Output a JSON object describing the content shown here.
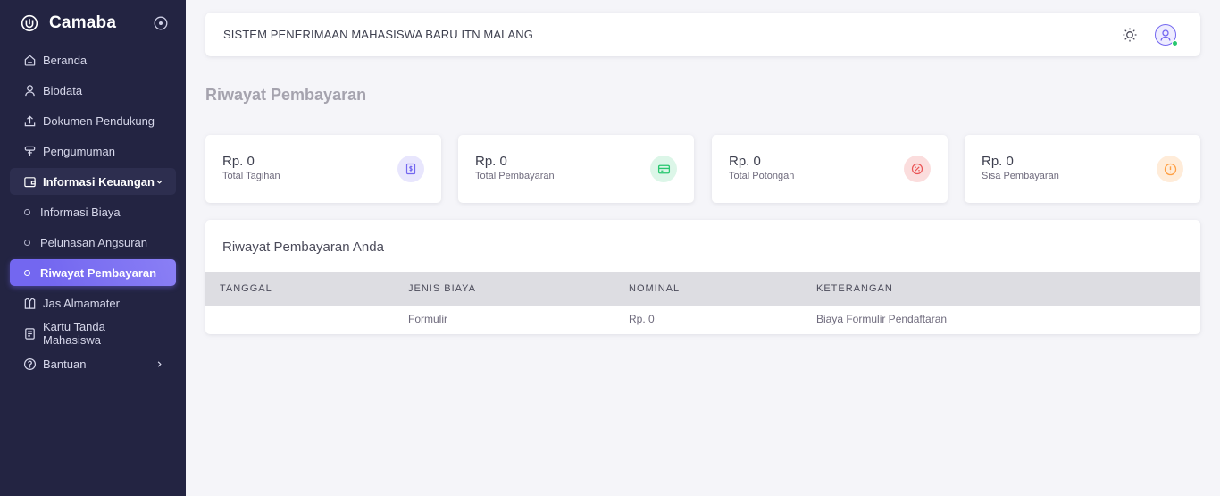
{
  "brand": {
    "name": "Camaba"
  },
  "sidebar": {
    "items": [
      {
        "label": "Beranda",
        "icon": "home-icon"
      },
      {
        "label": "Biodata",
        "icon": "user-icon"
      },
      {
        "label": "Dokumen Pendukung",
        "icon": "upload-icon"
      },
      {
        "label": "Pengumuman",
        "icon": "announcement-icon"
      },
      {
        "label": "Informasi Keuangan",
        "icon": "wallet-icon"
      },
      {
        "label": "Jas Almamater",
        "icon": "shirt-icon"
      },
      {
        "label": "Kartu Tanda Mahasiswa",
        "icon": "id-card-icon"
      },
      {
        "label": "Bantuan",
        "icon": "help-icon"
      }
    ],
    "submenu": [
      {
        "label": "Informasi Biaya"
      },
      {
        "label": "Pelunasan Angsuran"
      },
      {
        "label": "Riwayat Pembayaran"
      }
    ]
  },
  "navbar": {
    "title": "SISTEM PENERIMAAN MAHASISWA BARU ITN MALANG"
  },
  "page": {
    "heading": "Riwayat Pembayaran"
  },
  "stats": [
    {
      "amount": "Rp. 0",
      "label": "Total Tagihan",
      "icon": "invoice-icon",
      "color": "#7367f0",
      "bg": "#e8e6fd"
    },
    {
      "amount": "Rp. 0",
      "label": "Total Pembayaran",
      "icon": "credit-card-icon",
      "color": "#28c76f",
      "bg": "#dcf6e8"
    },
    {
      "amount": "Rp. 0",
      "label": "Total Potongan",
      "icon": "discount-icon",
      "color": "#ea5455",
      "bg": "#fbdddd"
    },
    {
      "amount": "Rp. 0",
      "label": "Sisa Pembayaran",
      "icon": "alert-icon",
      "color": "#ff9f43",
      "bg": "#ffecd9"
    }
  ],
  "table": {
    "title": "Riwayat Pembayaran Anda",
    "columns": [
      "TANGGAL",
      "JENIS BIAYA",
      "NOMINAL",
      "KETERANGAN"
    ],
    "rows": [
      {
        "tanggal": "",
        "jenis": "Formulir",
        "nominal": "Rp. 0",
        "keterangan": "Biaya Formulir Pendaftaran"
      }
    ]
  },
  "colors": {
    "sidebar": "#232442",
    "accent": "#7367f0",
    "online": "#28c76f"
  }
}
